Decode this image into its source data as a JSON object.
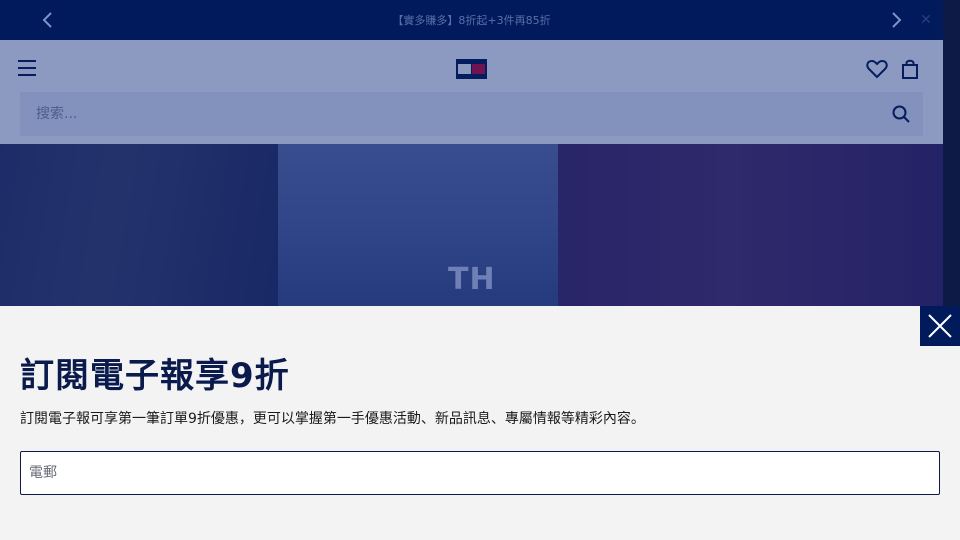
{
  "announcement": {
    "text": "【實多賺多】8折起+3件再85折",
    "prev_icon": "chevron-left-icon",
    "next_icon": "chevron-right-icon",
    "close_icon": "close-icon"
  },
  "header": {
    "menu_icon": "hamburger-menu-icon",
    "logo_icon": "tommy-flag-logo",
    "wishlist_icon": "heart-icon",
    "bag_icon": "shopping-bag-icon"
  },
  "search": {
    "placeholder": "搜索...",
    "icon": "search-icon"
  },
  "hero": {
    "mark": "TH"
  },
  "newsletter": {
    "title": "訂閱電子報享9折",
    "description": "訂閱電子報可享第一筆訂單9折優惠，更可以掌握第一手優惠活動、新品訊息、專屬情報等精彩內容。",
    "email_placeholder": "電郵",
    "close_icon": "close-icon"
  },
  "colors": {
    "navy": "#001a5c",
    "text_dark": "#0a1a4c",
    "panel_bg": "#f3f3f3",
    "flag_red": "#cc0c2f"
  }
}
